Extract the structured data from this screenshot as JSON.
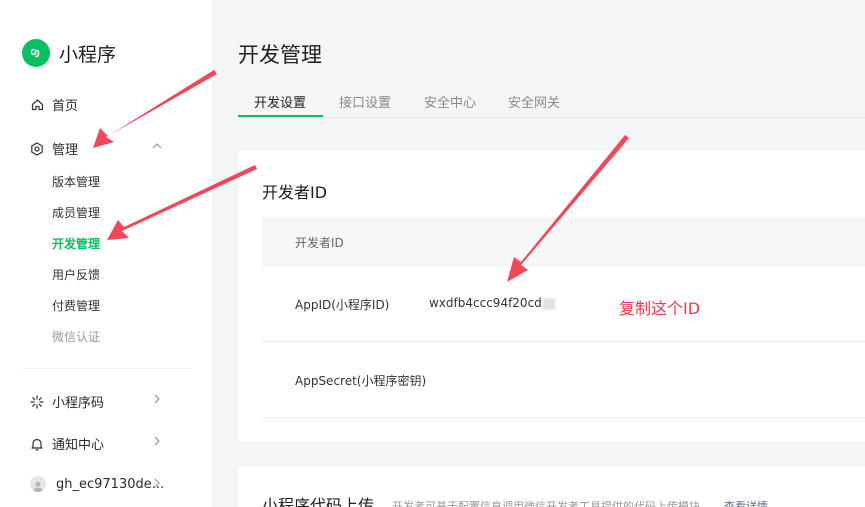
{
  "app": {
    "name": "小程序"
  },
  "sidebar": {
    "home": "首页",
    "manage": "管理",
    "sub_items": [
      "版本管理",
      "成员管理",
      "开发管理",
      "用户反馈",
      "付费管理",
      "微信认证"
    ],
    "mini_code": "小程序码",
    "notifications": "通知中心",
    "account": "gh_ec97130de..."
  },
  "page": {
    "title": "开发管理",
    "tabs": [
      "开发设置",
      "接口设置",
      "安全中心",
      "安全网关"
    ]
  },
  "developer_id": {
    "title": "开发者ID",
    "table_header": "开发者ID",
    "rows": [
      {
        "label": "AppID(小程序ID)",
        "value": "wxdfb4ccc94f20cd"
      },
      {
        "label": "AppSecret(小程序密钥)",
        "value": ""
      }
    ]
  },
  "code_upload": {
    "title": "小程序代码上传",
    "description": "开发者可基于配置信息调用微信开发者工具提供的代码上传模块",
    "link": "查看详情"
  },
  "annotation": {
    "text": "复制这个ID",
    "color": "#ee3b4d"
  },
  "colors": {
    "accent": "#07c160",
    "arrow": "#f0485a"
  }
}
